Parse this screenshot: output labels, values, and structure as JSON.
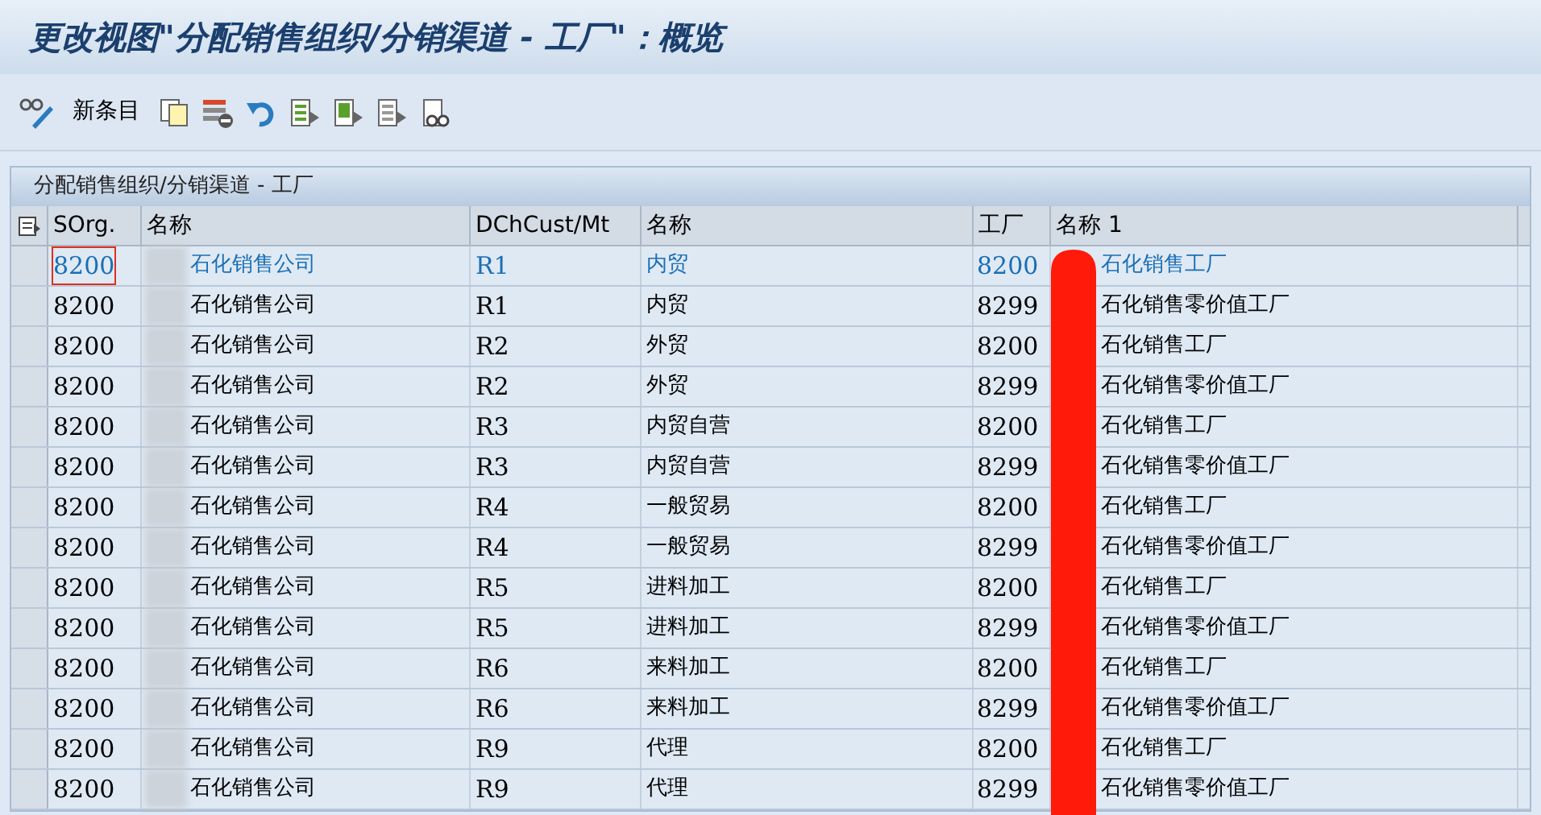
{
  "window": {
    "title": "更改视图\"分配销售组织/分销渠道 - 工厂\"：概览"
  },
  "toolbar": {
    "new_entries_label": "新条目"
  },
  "table": {
    "title": "分配销售组织/分销渠道 - 工厂",
    "columns": [
      "SOrg.",
      "名称",
      "DChCust/Mt",
      "名称",
      "工厂",
      "名称 1"
    ],
    "rows": [
      {
        "selected": true,
        "cells": [
          "8200",
          "石化销售公司",
          "R1",
          "内贸",
          "8200",
          "石化销售工厂"
        ]
      },
      {
        "selected": false,
        "cells": [
          "8200",
          "石化销售公司",
          "R1",
          "内贸",
          "8299",
          "石化销售零价值工厂"
        ]
      },
      {
        "selected": false,
        "cells": [
          "8200",
          "石化销售公司",
          "R2",
          "外贸",
          "8200",
          "石化销售工厂"
        ]
      },
      {
        "selected": false,
        "cells": [
          "8200",
          "石化销售公司",
          "R2",
          "外贸",
          "8299",
          "石化销售零价值工厂"
        ]
      },
      {
        "selected": false,
        "cells": [
          "8200",
          "石化销售公司",
          "R3",
          "内贸自营",
          "8200",
          "石化销售工厂"
        ]
      },
      {
        "selected": false,
        "cells": [
          "8200",
          "石化销售公司",
          "R3",
          "内贸自营",
          "8299",
          "石化销售零价值工厂"
        ]
      },
      {
        "selected": false,
        "cells": [
          "8200",
          "石化销售公司",
          "R4",
          "一般贸易",
          "8200",
          "石化销售工厂"
        ]
      },
      {
        "selected": false,
        "cells": [
          "8200",
          "石化销售公司",
          "R4",
          "一般贸易",
          "8299",
          "石化销售零价值工厂"
        ]
      },
      {
        "selected": false,
        "cells": [
          "8200",
          "石化销售公司",
          "R5",
          "进料加工",
          "8200",
          "石化销售工厂"
        ]
      },
      {
        "selected": false,
        "cells": [
          "8200",
          "石化销售公司",
          "R5",
          "进料加工",
          "8299",
          "石化销售零价值工厂"
        ]
      },
      {
        "selected": false,
        "cells": [
          "8200",
          "石化销售公司",
          "R6",
          "来料加工",
          "8200",
          "石化销售工厂"
        ]
      },
      {
        "selected": false,
        "cells": [
          "8200",
          "石化销售公司",
          "R6",
          "来料加工",
          "8299",
          "石化销售零价值工厂"
        ]
      },
      {
        "selected": false,
        "cells": [
          "8200",
          "石化销售公司",
          "R9",
          "代理",
          "8200",
          "石化销售工厂"
        ]
      },
      {
        "selected": false,
        "cells": [
          "8200",
          "石化销售公司",
          "R9",
          "代理",
          "8299",
          "石化销售零价值工厂"
        ]
      }
    ]
  }
}
